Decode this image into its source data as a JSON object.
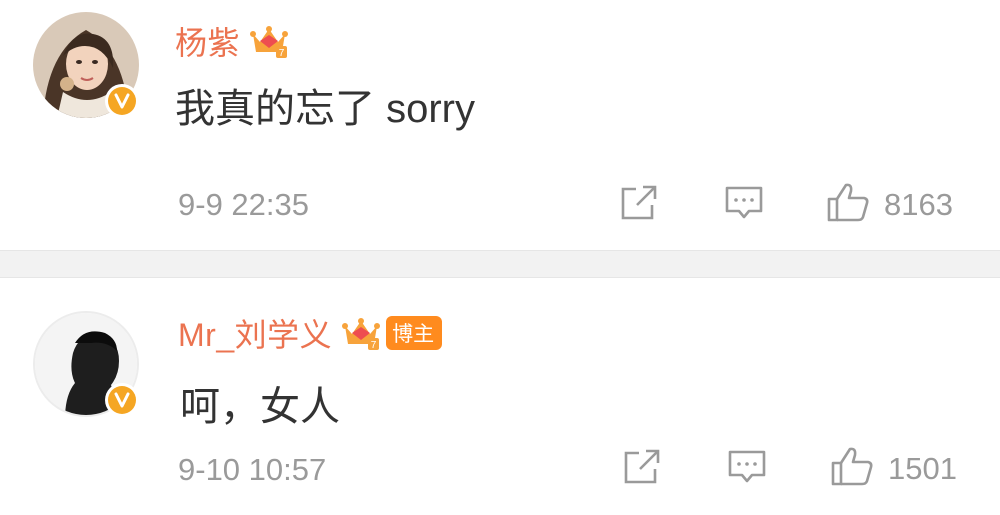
{
  "comments": [
    {
      "username": "杨紫",
      "text": "我真的忘了 sorry",
      "time": "9-9 22:35",
      "likes": "8163",
      "badge_level": "7",
      "host_label": ""
    },
    {
      "username": "Mr_刘学义",
      "text": "呵，女人",
      "time": "9-10 10:57",
      "likes": "1501",
      "badge_level": "7",
      "host_label": "博主"
    }
  ],
  "colors": {
    "username": "#eb7350",
    "text": "#333333",
    "meta": "#9a9a9a",
    "verified": "#f5a623",
    "host_tag": "#ff8b1e"
  },
  "icons": [
    "verified-icon",
    "crown-level-icon",
    "share-icon",
    "comment-icon",
    "like-icon"
  ]
}
